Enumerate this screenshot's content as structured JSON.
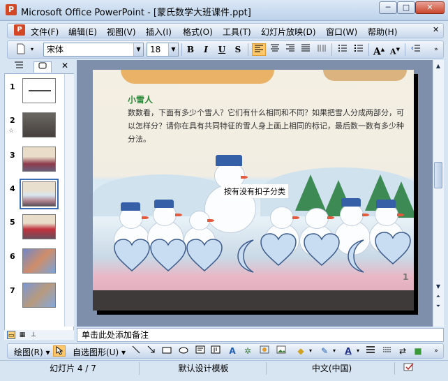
{
  "window": {
    "title": "Microsoft Office PowerPoint - [蒙氏数学大班课件.ppt]",
    "app_icon": "powerpoint-icon",
    "minimize": "─",
    "maximize": "□",
    "close": "✕"
  },
  "menu": {
    "items": [
      "文件(F)",
      "编辑(E)",
      "视图(V)",
      "插入(I)",
      "格式(O)",
      "工具(T)",
      "幻灯片放映(D)",
      "窗口(W)",
      "帮助(H)"
    ],
    "close": "✕"
  },
  "format_toolbar": {
    "font_name": "宋体",
    "font_size": "18",
    "bold": "B",
    "italic": "I",
    "underline": "U",
    "shadow": "S"
  },
  "slides_pane": {
    "tabs": [
      "outline-tab",
      "slides-tab"
    ],
    "close": "✕",
    "thumbnails": [
      {
        "number": "1"
      },
      {
        "number": "2"
      },
      {
        "number": "3"
      },
      {
        "number": "4"
      },
      {
        "number": "5"
      },
      {
        "number": "6"
      },
      {
        "number": "7"
      }
    ],
    "selected": 4
  },
  "slide": {
    "heading": "小雪人",
    "body": "数数看，下面有多少个雪人？它们有什么相同和不同？如果把雪人分成两部分，可以怎样分？请你在具有共同特征的雪人身上画上相同的标记，最后数一数有多少种分法。",
    "callout": "按有没有扣子分类",
    "page_number": "1"
  },
  "notes": {
    "placeholder": "单击此处添加备注"
  },
  "draw_toolbar": {
    "draw_menu": "绘图(R) ▾",
    "autoshapes_menu": "自选图形(U) ▾"
  },
  "status": {
    "slide_info": "幻灯片 4 / 7",
    "template": "默认设计模板",
    "language": "中文(中国)"
  },
  "colors": {
    "accent": "#3b6eb5",
    "chrome": "#d7e4f2",
    "heart_fill": "#c8dcf2",
    "heart_stroke": "#3e5c8a"
  }
}
